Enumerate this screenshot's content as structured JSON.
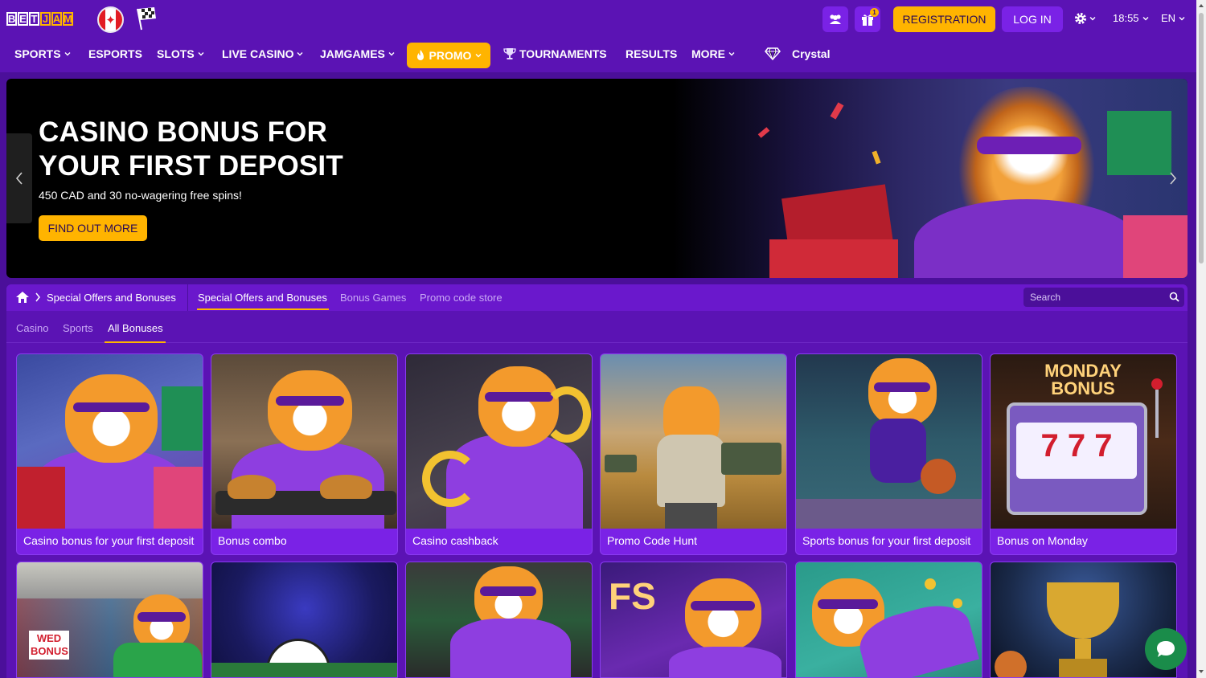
{
  "brand": {
    "logo_letters": [
      "B",
      "E",
      "T",
      "J",
      "A",
      "M"
    ]
  },
  "header": {
    "gift_badge": "1",
    "register_label": "REGISTRATION",
    "login_label": "LOG IN",
    "time": "18:55",
    "language": "EN"
  },
  "nav": {
    "items": [
      {
        "label": "SPORTS",
        "dropdown": true
      },
      {
        "label": "ESPORTS",
        "dropdown": false
      },
      {
        "label": "SLOTS",
        "dropdown": true
      },
      {
        "label": "LIVE CASINO",
        "dropdown": true
      },
      {
        "label": "JAMGAMES",
        "dropdown": true
      },
      {
        "label": "PROMO",
        "dropdown": true,
        "active": true
      },
      {
        "label": "TOURNAMENTS",
        "dropdown": false
      },
      {
        "label": "RESULTS",
        "dropdown": false
      },
      {
        "label": "MORE",
        "dropdown": true
      }
    ],
    "crystal_label": "Crystal"
  },
  "hero": {
    "title": "CASINO BONUS FOR YOUR FIRST DEPOSIT",
    "subtitle": "450 CAD and 30 no-wagering free spins!",
    "cta": "FIND OUT MORE"
  },
  "offers": {
    "breadcrumb": "Special Offers and Bonuses",
    "tabs": [
      {
        "label": "Special Offers and Bonuses",
        "active": true
      },
      {
        "label": "Bonus Games",
        "active": false
      },
      {
        "label": "Promo code store",
        "active": false
      }
    ],
    "search_placeholder": "Search",
    "subtabs": [
      {
        "label": "Casino",
        "active": false
      },
      {
        "label": "Sports",
        "active": false
      },
      {
        "label": "All Bonuses",
        "active": true
      }
    ],
    "cards": [
      {
        "title": "Casino bonus for your first deposit"
      },
      {
        "title": "Bonus combo"
      },
      {
        "title": "Casino cashback"
      },
      {
        "title": "Promo Code Hunt"
      },
      {
        "title": "Sports bonus for your first deposit"
      },
      {
        "title": "Bonus on Monday"
      }
    ],
    "monday_sign": "MONDAY BONUS",
    "slot_digits": "7 7 7",
    "wed_sign": "WED BONUS",
    "fs_sign": "FS"
  },
  "colors": {
    "background": "#4b0f9a",
    "bar": "#5b13b4",
    "accent": "#ffb400",
    "card": "#7a22e6"
  },
  "icons": [
    "users-icon",
    "gift-icon",
    "gear-icon",
    "chevron-down-icon",
    "fire-icon",
    "trophy-icon",
    "diamond-icon",
    "home-icon",
    "search-icon",
    "chat-icon",
    "arrow-left-icon",
    "arrow-right-icon"
  ]
}
